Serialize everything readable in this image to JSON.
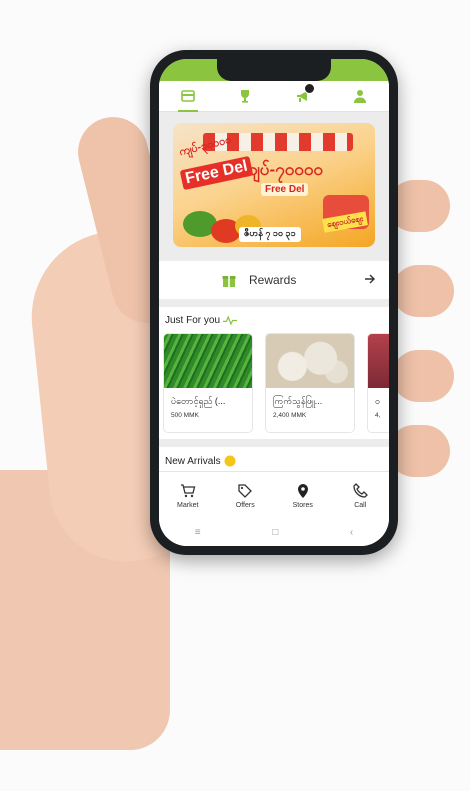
{
  "colors": {
    "accent": "#8bc53f",
    "text": "#222222"
  },
  "top_nav": [
    {
      "icon": "card-icon",
      "active": true
    },
    {
      "icon": "trophy-icon"
    },
    {
      "icon": "megaphone-icon",
      "has_badge": true
    },
    {
      "icon": "person-icon"
    }
  ],
  "banner": {
    "promo_line1": "ကျပ်-၃၀၀၀၀",
    "promo_line2": "ကျပ်-၇၀၀၀၀",
    "free_delivery": "Free Del",
    "free_delivery_2": "Free Del",
    "date": "ဇီဟန် ၇ ၁၀ ၃၁",
    "cart_label": "ဈေးဝယ်စျေး"
  },
  "rewards": {
    "label": "Rewards"
  },
  "just_for_you": {
    "title": "Just For you",
    "products": [
      {
        "name": "ပဲတောင့်ရှည် (...",
        "price": "500 MMK"
      },
      {
        "name": "ကြက်သွန်ဖြူ...",
        "price": "2,400 MMK"
      },
      {
        "name": "ဝ",
        "price": "4,"
      }
    ]
  },
  "new_arrivals": {
    "title": "New Arrivals"
  },
  "bottom_nav": [
    {
      "label": "Market",
      "icon": "cart-icon"
    },
    {
      "label": "Offers",
      "icon": "tag-icon"
    },
    {
      "label": "Stores",
      "icon": "location-pin-icon"
    },
    {
      "label": "Call",
      "icon": "phone-icon"
    }
  ],
  "system_nav": {
    "recent": "≡",
    "home": "□",
    "back": "‹"
  }
}
